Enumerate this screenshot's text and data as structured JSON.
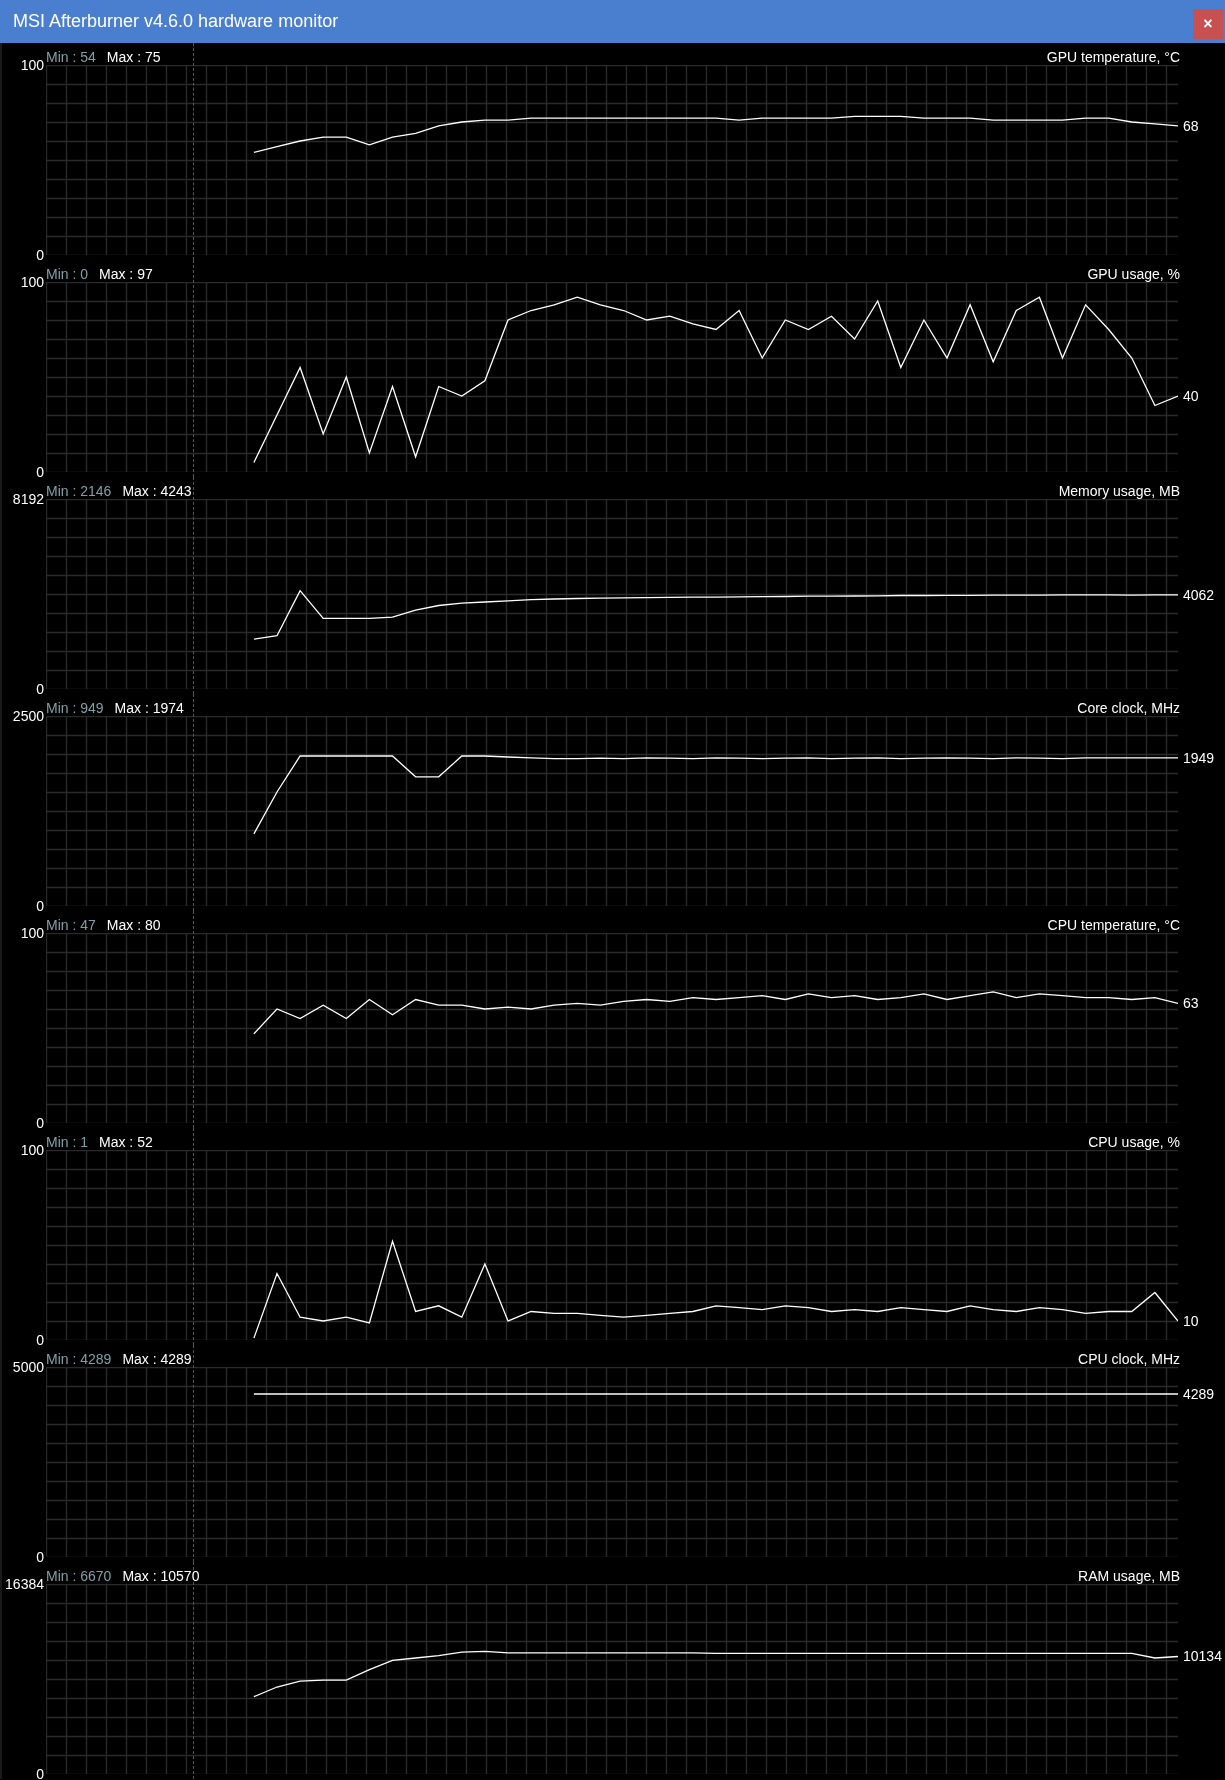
{
  "window": {
    "title": "MSI Afterburner v4.6.0 hardware monitor",
    "close_button": "×"
  },
  "graphs": [
    {
      "title": "GPU temperature, °C",
      "min_label": "Min : 54",
      "max_label": "Max : 75",
      "current": "68",
      "chart_data": {
        "type": "line",
        "grid": true,
        "ylim": [
          0,
          100
        ],
        "yticks": [
          0,
          100
        ],
        "series": [
          {
            "color": "#ffffff",
            "values": [
              null,
              null,
              null,
              null,
              null,
              null,
              null,
              null,
              null,
              54,
              57,
              60,
              62,
              62,
              58,
              62,
              64,
              68,
              70,
              71,
              71,
              72,
              72,
              72,
              72,
              72,
              72,
              72,
              72,
              72,
              71,
              72,
              72,
              72,
              72,
              73,
              73,
              73,
              72,
              72,
              72,
              71,
              71,
              71,
              71,
              72,
              72,
              70,
              69,
              68
            ]
          }
        ]
      }
    },
    {
      "title": "GPU usage, %",
      "min_label": "Min : 0",
      "max_label": "Max : 97",
      "current": "40",
      "chart_data": {
        "type": "line",
        "grid": true,
        "ylim": [
          0,
          100
        ],
        "yticks": [
          0,
          100
        ],
        "series": [
          {
            "color": "#ffffff",
            "values": [
              null,
              null,
              null,
              null,
              null,
              null,
              null,
              null,
              null,
              5,
              30,
              55,
              20,
              50,
              10,
              45,
              8,
              45,
              40,
              48,
              80,
              85,
              88,
              92,
              88,
              85,
              80,
              82,
              78,
              75,
              85,
              60,
              80,
              75,
              82,
              70,
              90,
              55,
              80,
              60,
              88,
              58,
              85,
              92,
              60,
              88,
              75,
              60,
              35,
              40
            ]
          }
        ]
      }
    },
    {
      "title": "Memory usage, MB",
      "min_label": "Min : 2146",
      "max_label": "Max : 4243",
      "current": "4062",
      "chart_data": {
        "type": "line",
        "grid": true,
        "ylim": [
          0,
          8192
        ],
        "yticks": [
          0,
          8192
        ],
        "series": [
          {
            "color": "#ffffff",
            "values": [
              null,
              null,
              null,
              null,
              null,
              null,
              null,
              null,
              null,
              2146,
              2300,
              4243,
              3050,
              3050,
              3050,
              3100,
              3400,
              3600,
              3700,
              3750,
              3800,
              3850,
              3880,
              3900,
              3920,
              3930,
              3940,
              3950,
              3960,
              3960,
              3970,
              3980,
              3990,
              4000,
              4000,
              4010,
              4020,
              4030,
              4030,
              4040,
              4040,
              4050,
              4050,
              4050,
              4060,
              4060,
              4060,
              4050,
              4060,
              4062
            ]
          }
        ]
      }
    },
    {
      "title": "Core clock, MHz",
      "min_label": "Min : 949",
      "max_label": "Max : 1974",
      "current": "1949",
      "chart_data": {
        "type": "line",
        "grid": true,
        "ylim": [
          0,
          2500
        ],
        "yticks": [
          0,
          2500
        ],
        "series": [
          {
            "color": "#ffffff",
            "values": [
              null,
              null,
              null,
              null,
              null,
              null,
              null,
              null,
              null,
              949,
              1500,
              1974,
              1974,
              1974,
              1974,
              1974,
              1700,
              1700,
              1974,
              1974,
              1960,
              1950,
              1940,
              1940,
              1945,
              1940,
              1950,
              1945,
              1940,
              1950,
              1945,
              1940,
              1945,
              1950,
              1940,
              1945,
              1950,
              1940,
              1945,
              1950,
              1945,
              1940,
              1950,
              1945,
              1940,
              1950,
              1950,
              1949,
              1949,
              1949
            ]
          }
        ]
      }
    },
    {
      "title": "CPU temperature, °C",
      "min_label": "Min : 47",
      "max_label": "Max : 80",
      "current": "63",
      "chart_data": {
        "type": "line",
        "grid": true,
        "ylim": [
          0,
          100
        ],
        "yticks": [
          0,
          100
        ],
        "series": [
          {
            "color": "#ffffff",
            "values": [
              null,
              null,
              null,
              null,
              null,
              null,
              null,
              null,
              null,
              47,
              60,
              55,
              62,
              55,
              65,
              57,
              65,
              62,
              62,
              60,
              61,
              60,
              62,
              63,
              62,
              64,
              65,
              64,
              66,
              65,
              66,
              67,
              65,
              68,
              66,
              67,
              65,
              66,
              68,
              65,
              67,
              69,
              66,
              68,
              67,
              66,
              66,
              65,
              66,
              63
            ]
          }
        ]
      }
    },
    {
      "title": "CPU usage, %",
      "min_label": "Min : 1",
      "max_label": "Max : 52",
      "current": "10",
      "chart_data": {
        "type": "line",
        "grid": true,
        "ylim": [
          0,
          100
        ],
        "yticks": [
          0,
          100
        ],
        "series": [
          {
            "color": "#ffffff",
            "values": [
              null,
              null,
              null,
              null,
              null,
              null,
              null,
              null,
              null,
              1,
              35,
              12,
              10,
              12,
              9,
              52,
              15,
              18,
              12,
              40,
              10,
              15,
              14,
              14,
              13,
              12,
              13,
              14,
              15,
              18,
              17,
              16,
              18,
              17,
              15,
              16,
              15,
              17,
              16,
              15,
              18,
              16,
              15,
              17,
              16,
              14,
              15,
              15,
              25,
              10
            ]
          }
        ]
      }
    },
    {
      "title": "CPU clock, MHz",
      "min_label": "Min : 4289",
      "max_label": "Max : 4289",
      "current": "4289",
      "chart_data": {
        "type": "line",
        "grid": true,
        "ylim": [
          0,
          5000
        ],
        "yticks": [
          0,
          5000
        ],
        "series": [
          {
            "color": "#ffffff",
            "values": [
              null,
              null,
              null,
              null,
              null,
              null,
              null,
              null,
              null,
              4289,
              4289,
              4289,
              4289,
              4289,
              4289,
              4289,
              4289,
              4289,
              4289,
              4289,
              4289,
              4289,
              4289,
              4289,
              4289,
              4289,
              4289,
              4289,
              4289,
              4289,
              4289,
              4289,
              4289,
              4289,
              4289,
              4289,
              4289,
              4289,
              4289,
              4289,
              4289,
              4289,
              4289,
              4289,
              4289,
              4289,
              4289,
              4289,
              4289,
              4289
            ]
          }
        ]
      }
    },
    {
      "title": "RAM usage, MB",
      "min_label": "Min : 6670",
      "max_label": "Max : 10570",
      "current": "10134",
      "chart_data": {
        "type": "line",
        "grid": true,
        "ylim": [
          0,
          16384
        ],
        "yticks": [
          0,
          16384
        ],
        "series": [
          {
            "color": "#ffffff",
            "values": [
              null,
              null,
              null,
              null,
              null,
              null,
              null,
              null,
              null,
              6670,
              7500,
              8000,
              8100,
              8100,
              9000,
              9800,
              10000,
              10200,
              10500,
              10570,
              10450,
              10450,
              10450,
              10450,
              10450,
              10450,
              10450,
              10450,
              10450,
              10400,
              10400,
              10400,
              10400,
              10400,
              10400,
              10400,
              10400,
              10400,
              10400,
              10400,
              10400,
              10400,
              10400,
              10400,
              10400,
              10400,
              10400,
              10400,
              10000,
              10134
            ]
          }
        ]
      }
    }
  ]
}
